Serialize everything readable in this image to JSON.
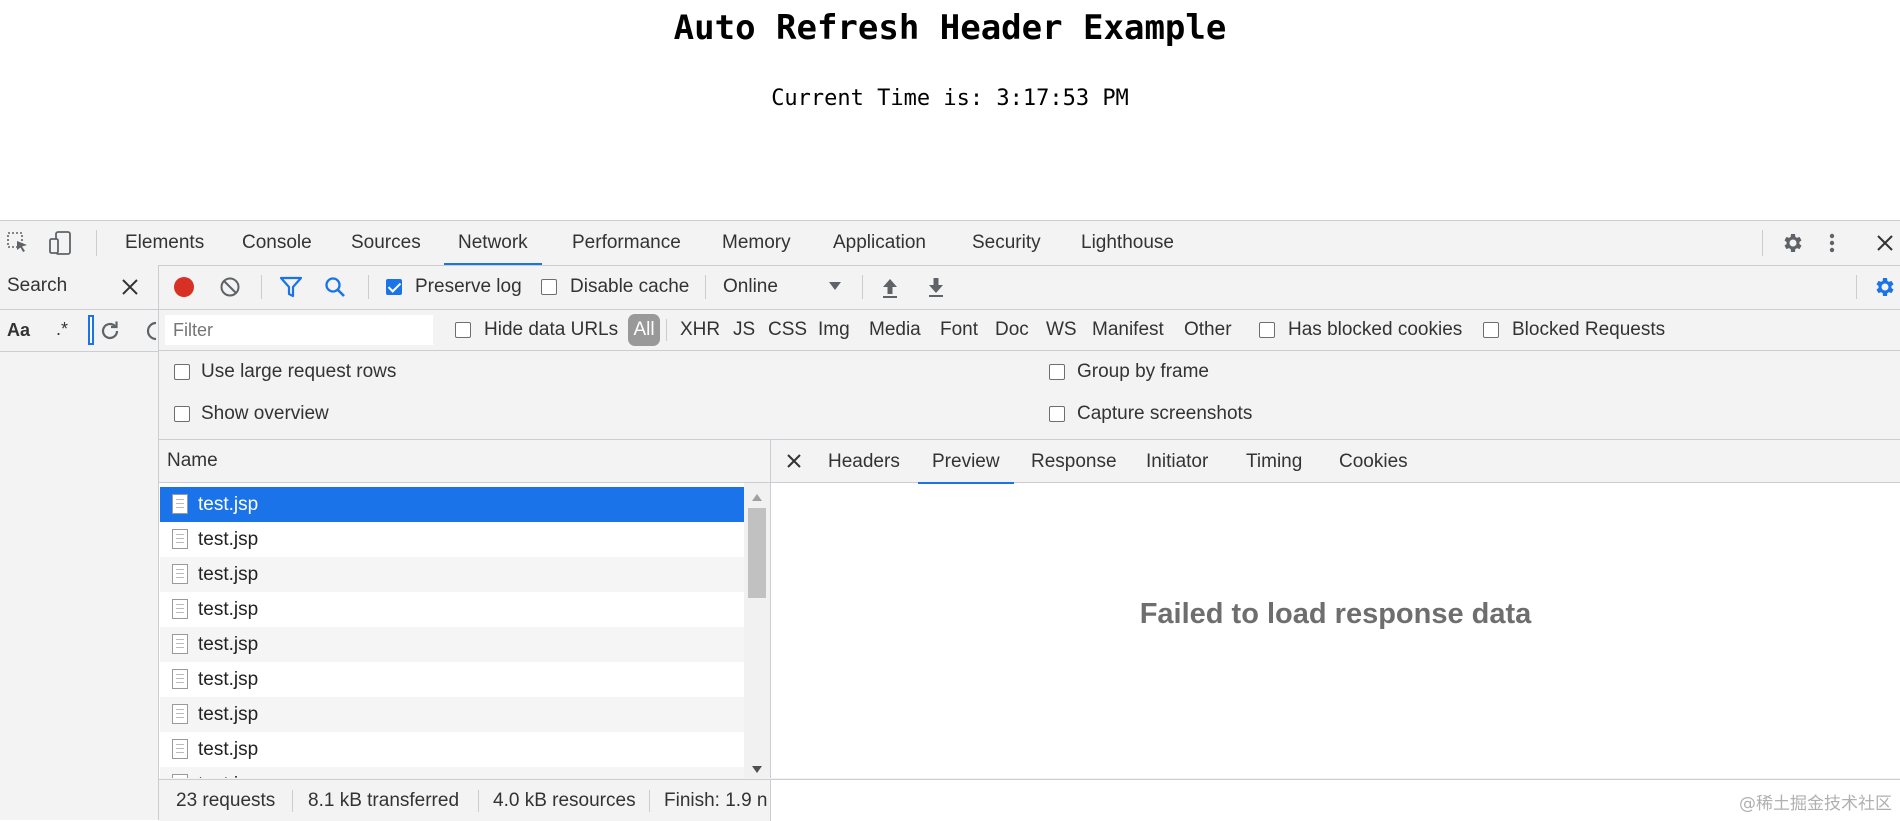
{
  "page": {
    "title": "Auto Refresh Header Example",
    "time_line": "Current Time is: 3:17:53 PM"
  },
  "devtools": {
    "tabs": [
      "Elements",
      "Console",
      "Sources",
      "Network",
      "Performance",
      "Memory",
      "Application",
      "Security",
      "Lighthouse"
    ],
    "active_tab": "Network",
    "toolbar": {
      "preserve_log": "Preserve log",
      "disable_cache": "Disable cache",
      "throttle": "Online"
    },
    "search": {
      "label": "Search",
      "case": "Aa",
      "regex": ".*"
    },
    "filter": {
      "placeholder": "Filter",
      "hide_data_urls": "Hide data URLs",
      "types": [
        "All",
        "XHR",
        "JS",
        "CSS",
        "Img",
        "Media",
        "Font",
        "Doc",
        "WS",
        "Manifest",
        "Other"
      ],
      "has_blocked_cookies": "Has blocked cookies",
      "blocked_requests": "Blocked Requests"
    },
    "settings": {
      "large_rows": "Use large request rows",
      "show_overview": "Show overview",
      "group_by_frame": "Group by frame",
      "capture_screenshots": "Capture screenshots"
    },
    "requests": {
      "column_name": "Name",
      "rows": [
        "test.jsp",
        "test.jsp",
        "test.jsp",
        "test.jsp",
        "test.jsp",
        "test.jsp",
        "test.jsp",
        "test.jsp",
        "test.jsp"
      ]
    },
    "detail": {
      "tabs": [
        "Headers",
        "Preview",
        "Response",
        "Initiator",
        "Timing",
        "Cookies"
      ],
      "active_tab": "Preview",
      "message": "Failed to load response data"
    },
    "status": {
      "requests": "23 requests",
      "transferred": "8.1 kB transferred",
      "resources": "4.0 kB resources",
      "finish": "Finish: 1.9 n"
    }
  },
  "watermark": "@稀土掘金技术社区",
  "colors": {
    "accent": "#1a73e8",
    "record": "#d93025"
  }
}
